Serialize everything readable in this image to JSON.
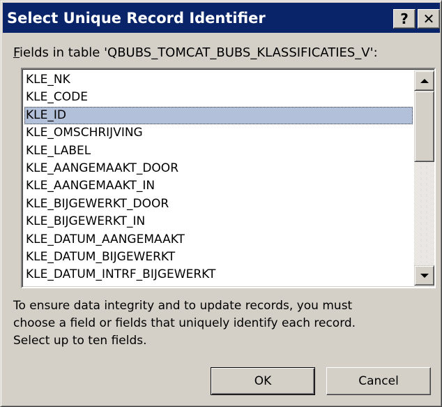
{
  "window": {
    "title": "Select Unique Record Identifier",
    "help_label": "?",
    "close_label": "✕"
  },
  "fields_label": {
    "accel_char": "F",
    "rest": "ields in table 'QBUBS_TOMCAT_BUBS_KLASSIFICATIES_V':"
  },
  "fields": [
    {
      "label": "KLE_NK",
      "selected": false
    },
    {
      "label": "KLE_CODE",
      "selected": false
    },
    {
      "label": "KLE_ID",
      "selected": true
    },
    {
      "label": "KLE_OMSCHRIJVING",
      "selected": false
    },
    {
      "label": "KLE_LABEL",
      "selected": false
    },
    {
      "label": "KLE_AANGEMAAKT_DOOR",
      "selected": false
    },
    {
      "label": "KLE_AANGEMAAKT_IN",
      "selected": false
    },
    {
      "label": "KLE_BIJGEWERKT_DOOR",
      "selected": false
    },
    {
      "label": "KLE_BIJGEWERKT_IN",
      "selected": false
    },
    {
      "label": "KLE_DATUM_AANGEMAAKT",
      "selected": false
    },
    {
      "label": "KLE_DATUM_BIJGEWERKT",
      "selected": false
    },
    {
      "label": "KLE_DATUM_INTRF_BIJGEWERKT",
      "selected": false
    }
  ],
  "info_lines": [
    "To ensure data integrity and to update records, you must",
    "choose a field or fields that uniquely identify each record.",
    "Select up to ten fields."
  ],
  "buttons": {
    "ok_label": "OK",
    "cancel_label": "Cancel"
  },
  "colors": {
    "titlebar": "#0a246a",
    "selection": "#b3c0d9",
    "face": "#d4d0c8"
  }
}
